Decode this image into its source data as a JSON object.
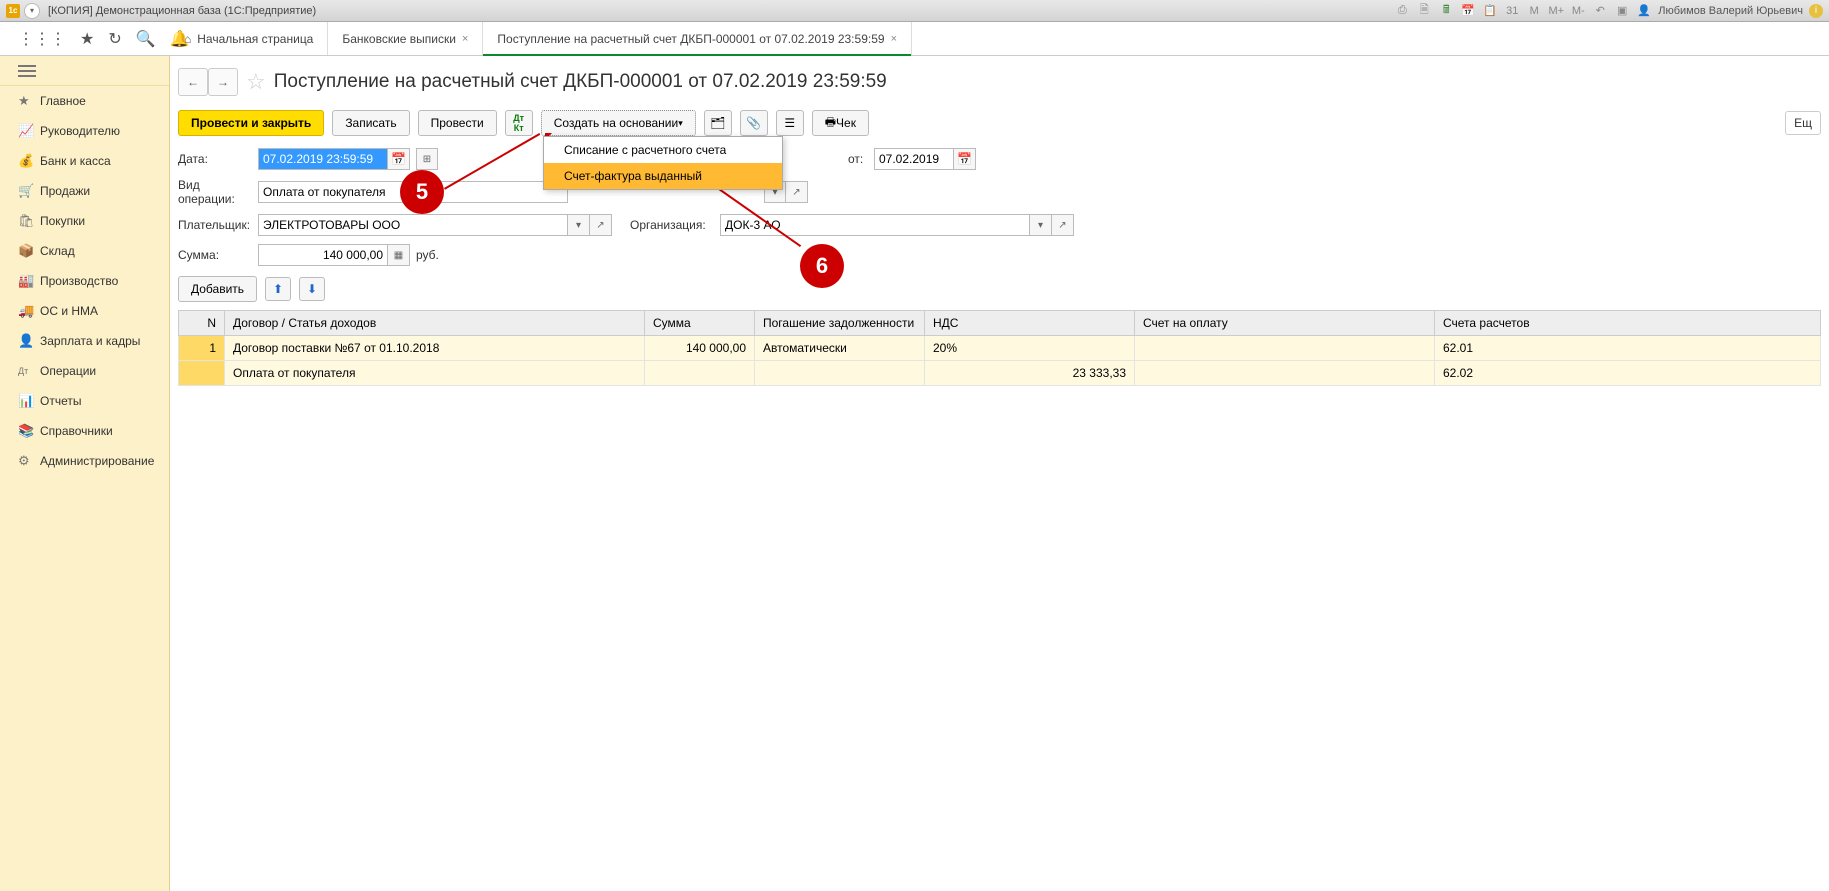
{
  "window_title": "[КОПИЯ] Демонстрационная база  (1С:Предприятие)",
  "user_name": "Любимов Валерий Юрьевич",
  "title_icons": [
    "M",
    "M+",
    "M-"
  ],
  "tabs": {
    "home": "Начальная страница",
    "t1": "Банковские выписки",
    "t2": "Поступление на расчетный счет ДКБП-000001 от 07.02.2019 23:59:59"
  },
  "sidebar": [
    {
      "icon": "★",
      "label": "Главное"
    },
    {
      "icon": "📈",
      "label": "Руководителю"
    },
    {
      "icon": "💰",
      "label": "Банк и касса"
    },
    {
      "icon": "🛒",
      "label": "Продажи"
    },
    {
      "icon": "🛍",
      "label": "Покупки"
    },
    {
      "icon": "📦",
      "label": "Склад"
    },
    {
      "icon": "🏭",
      "label": "Производство"
    },
    {
      "icon": "🚚",
      "label": "ОС и НМА"
    },
    {
      "icon": "👤",
      "label": "Зарплата и кадры"
    },
    {
      "icon": "Дт",
      "label": "Операции"
    },
    {
      "icon": "📊",
      "label": "Отчеты"
    },
    {
      "icon": "📚",
      "label": "Справочники"
    },
    {
      "icon": "⚙",
      "label": "Администрирование"
    }
  ],
  "page_title": "Поступление на расчетный счет ДКБП-000001 от 07.02.2019 23:59:59",
  "toolbar": {
    "post_close": "Провести и закрыть",
    "save": "Записать",
    "post": "Провести",
    "create_based": "Создать на основании",
    "cheque": "Чек",
    "more": "Ещ"
  },
  "dropdown": {
    "item1": "Списание с расчетного счета",
    "item2": "Счет-фактура выданный"
  },
  "form": {
    "date_label": "Дата:",
    "date_value": "07.02.2019 23:59:59",
    "from_label": "от:",
    "from_value": "07.02.2019",
    "op_label": "Вид операции:",
    "op_value": "Оплата от покупателя",
    "payer_label": "Плательщик:",
    "payer_value": "ЭЛЕКТРОТОВАРЫ ООО",
    "org_label": "Организация:",
    "org_value": "ДОК-3 АО",
    "sum_label": "Сумма:",
    "sum_value": "140 000,00",
    "currency": "руб.",
    "add_btn": "Добавить"
  },
  "table": {
    "headers": {
      "n": "N",
      "contract": "Договор / Статья доходов",
      "sum": "Сумма",
      "debt": "Погашение задолженности",
      "vat": "НДС",
      "invoice": "Счет на оплату",
      "accounts": "Счета расчетов"
    },
    "rows": [
      {
        "n": "1",
        "contract": "Договор поставки №67 от 01.10.2018",
        "sum": "140 000,00",
        "debt": "Автоматически",
        "vat": "20%",
        "invoice": "",
        "account": "62.01"
      },
      {
        "n": "",
        "contract": "Оплата от покупателя",
        "sum": "",
        "debt": "",
        "vat": "23 333,33",
        "invoice": "",
        "account": "62.02"
      }
    ]
  },
  "callouts": {
    "c5": "5",
    "c6": "6"
  }
}
